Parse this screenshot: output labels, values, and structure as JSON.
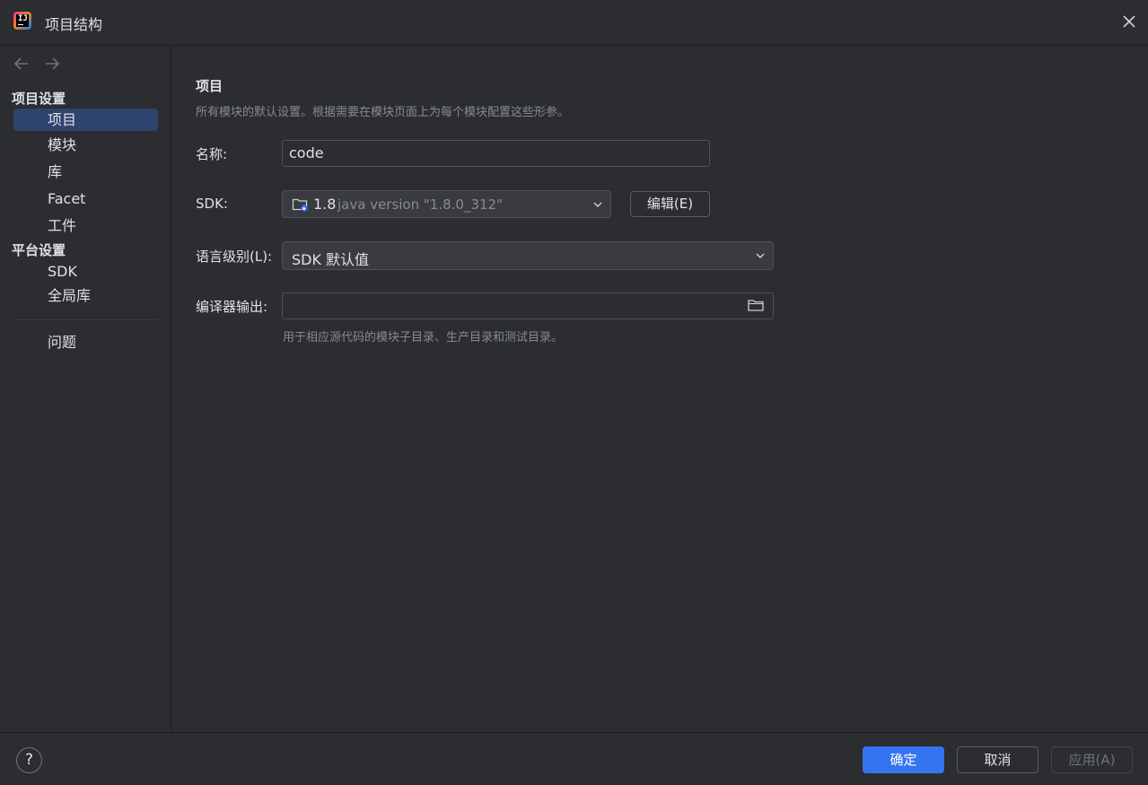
{
  "window": {
    "title": "项目结构"
  },
  "sidebar": {
    "project_settings_title": "项目设置",
    "project_items": [
      {
        "label": "项目",
        "selected": true
      },
      {
        "label": "模块"
      },
      {
        "label": "库"
      },
      {
        "label": "Facet"
      },
      {
        "label": "工件"
      }
    ],
    "platform_settings_title": "平台设置",
    "platform_items": [
      {
        "label": "SDK"
      },
      {
        "label": "全局库"
      }
    ],
    "problems_label": "问题"
  },
  "main": {
    "heading": "项目",
    "description": "所有模块的默认设置。根据需要在模块页面上为每个模块配置这些形参。",
    "name_label": "名称:",
    "name_value": "code",
    "sdk_label": "SDK:",
    "sdk_version": "1.8",
    "sdk_detail": "java version \"1.8.0_312\"",
    "edit_button": "编辑(E)",
    "language_level_label": "语言级别(L):",
    "language_level_value": "SDK 默认值",
    "compiler_output_label": "编译器输出:",
    "compiler_output_value": "",
    "compiler_output_hint": "用于相应源代码的模块子目录、生产目录和测试目录。"
  },
  "footer": {
    "help_label": "?",
    "ok_button": "确定",
    "cancel_button": "取消",
    "apply_button": "应用(A)"
  },
  "colors": {
    "background": "#2b2d30",
    "selection": "#2e436e",
    "primary_button": "#3574f0",
    "border": "#4e5157",
    "secondary_text": "#868a91"
  },
  "icons": [
    "intellij-idea-icon",
    "close-icon",
    "back-arrow-icon",
    "forward-arrow-icon",
    "sdk-folder-icon",
    "chevron-down-icon",
    "folder-browse-icon",
    "help-icon"
  ]
}
